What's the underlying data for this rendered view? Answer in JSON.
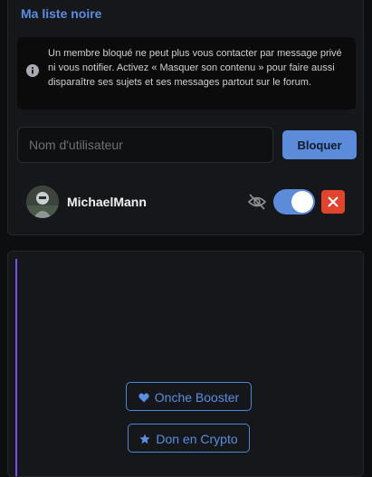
{
  "blacklist": {
    "title": "Ma liste noire",
    "info": "Un membre bloqué ne peut plus vous contacter par message privé ni vous notifier. Activez « Masquer son contenu » pour faire aussi disparaître ses sujets et ses messages partout sur le forum.",
    "input_placeholder": "Nom d'utilisateur",
    "input_value": "",
    "block_label": "Bloquer",
    "users": [
      {
        "name": "MichaelMann",
        "hide_content": true
      }
    ]
  },
  "sidebar": {
    "booster_label": "Onche Booster",
    "crypto_label": "Don en Crypto"
  },
  "icons": [
    "info-icon",
    "eye-off-icon",
    "close-icon",
    "heart-icon",
    "star-icon"
  ],
  "colors": {
    "accent": "#5b8bd9",
    "danger": "#e0442d",
    "sidebar_line": "#7a4ff0",
    "background": "#0d0e10",
    "card": "#16171a"
  }
}
